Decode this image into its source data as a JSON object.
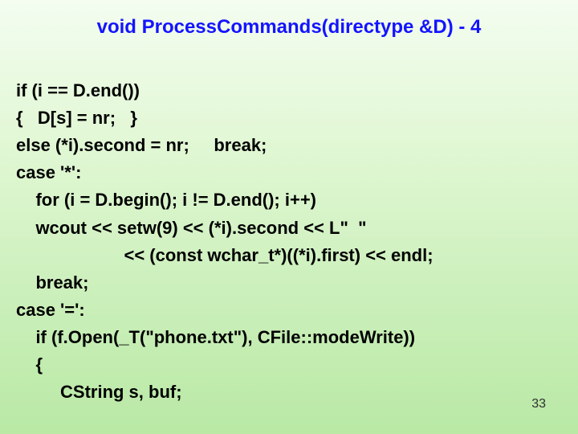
{
  "title": "void ProcessCommands(directype  &D) - 4",
  "code": {
    "l1": "if (i == D.end())",
    "l2": "{   D[s] = nr;   }",
    "l3": "else (*i).second = nr;     break;",
    "l4": "case '*':",
    "l5": "    for (i = D.begin(); i != D.end(); i++)",
    "l6": "    wcout << setw(9) << (*i).second << L\"  \"",
    "l7": "                      << (const wchar_t*)((*i).first) << endl;",
    "l8": "    break;",
    "l9": "case '=':",
    "l10": "    if (f.Open(_T(\"phone.txt\"), CFile::modeWrite))",
    "l11": "    {",
    "l12": "         CString s, buf;"
  },
  "page_number": "33"
}
